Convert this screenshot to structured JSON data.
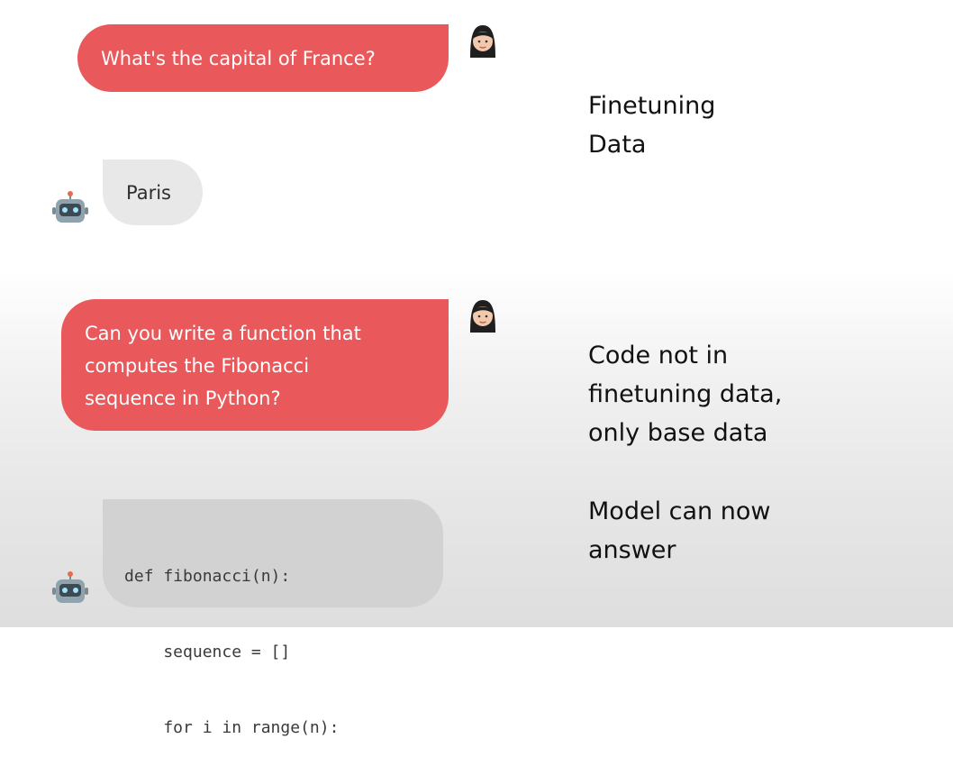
{
  "chat": {
    "q1": "What's the capital of France?",
    "a1": "Paris",
    "q2": [
      "Can you write a function that",
      "computes the Fibonacci",
      "sequence in Python?"
    ],
    "code": [
      "def fibonacci(n):",
      "    sequence = []",
      "    for i in range(n):"
    ]
  },
  "notes": {
    "finetuning": [
      "Finetuning",
      "Data"
    ],
    "code_not_in": [
      "Code not in",
      "finetuning data,",
      "only base data"
    ],
    "model_can": [
      "Model can now",
      "answer"
    ]
  },
  "avatars": {
    "user": "woman-avatar-icon",
    "bot": "robot-avatar-icon"
  },
  "colors": {
    "user_bubble": "#e9585a",
    "bot_bubble": "#e8e8e8",
    "code_bubble": "#d2d2d2"
  }
}
